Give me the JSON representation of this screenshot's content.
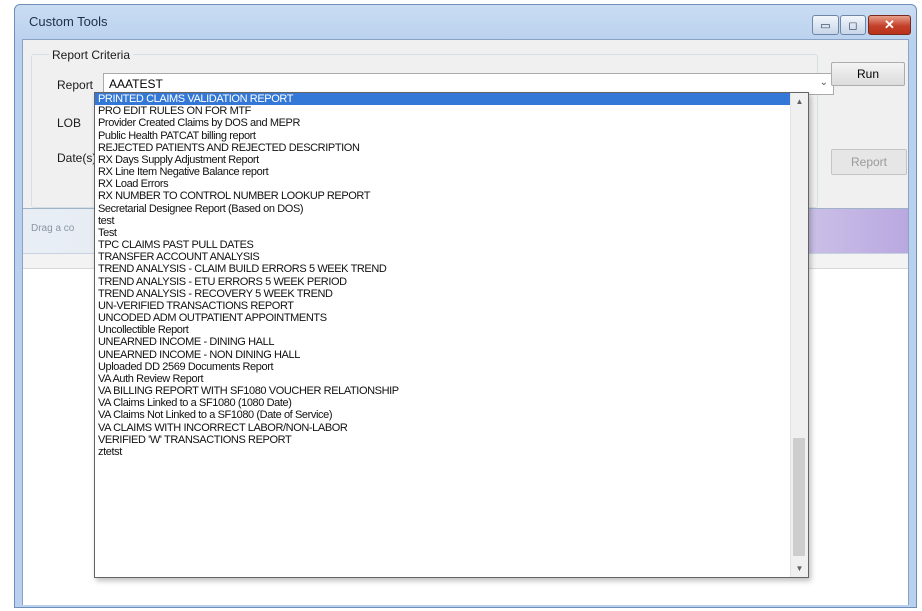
{
  "window": {
    "title": "Custom Tools",
    "minimize_glyph": "▭",
    "maximize_glyph": "◻",
    "close_glyph": "✕"
  },
  "criteria": {
    "group_title": "Report Criteria",
    "report_label": "Report",
    "lob_label": "LOB",
    "dates_label": "Date(s)",
    "report_selected": "AAATEST",
    "run_label": "Run",
    "report_button_label": "Report"
  },
  "grid": {
    "drag_hint": "Drag a co"
  },
  "dropdown": {
    "selected_index": 0,
    "scroll_position_fraction": 0.78,
    "items": [
      "PRINTED CLAIMS VALIDATION REPORT",
      "PRO EDIT RULES ON FOR MTF",
      "Provider Created Claims by DOS and MEPR",
      "Public Health PATCAT billing report",
      "REJECTED PATIENTS AND REJECTED DESCRIPTION",
      "RX Days Supply Adjustment Report",
      "RX Line Item Negative Balance report",
      "RX Load Errors",
      "RX NUMBER TO CONTROL NUMBER LOOKUP REPORT",
      "Secretarial Designee Report (Based on DOS)",
      "test",
      "Test",
      "TPC CLAIMS PAST PULL DATES",
      "TRANSFER ACCOUNT ANALYSIS",
      "TREND ANALYSIS - CLAIM BUILD ERRORS 5 WEEK TREND",
      "TREND ANALYSIS - ETU ERRORS 5 WEEK PERIOD",
      "TREND ANALYSIS - RECOVERY 5 WEEK TREND",
      "UN-VERIFIED TRANSACTIONS REPORT",
      "UNCODED ADM OUTPATIENT APPOINTMENTS",
      "Uncollectible Report",
      "UNEARNED INCOME - DINING HALL",
      "UNEARNED INCOME - NON DINING HALL",
      "Uploaded DD 2569 Documents Report",
      "VA Auth Review Report",
      "VA BILLING REPORT WITH SF1080 VOUCHER RELATIONSHIP",
      "VA Claims Linked to a SF1080 (1080 Date)",
      "VA Claims Not Linked to a SF1080 (Date of Service)",
      "VA CLAIMS WITH INCORRECT LABOR/NON-LABOR",
      "VERIFIED 'W' TRANSACTIONS REPORT",
      "ztetst"
    ],
    "scroll_up_glyph": "▲",
    "scroll_down_glyph": "▼"
  },
  "colors": {
    "selection": "#3378d6",
    "title_bar": "#b9d1ee",
    "close_button": "#c4402a"
  }
}
